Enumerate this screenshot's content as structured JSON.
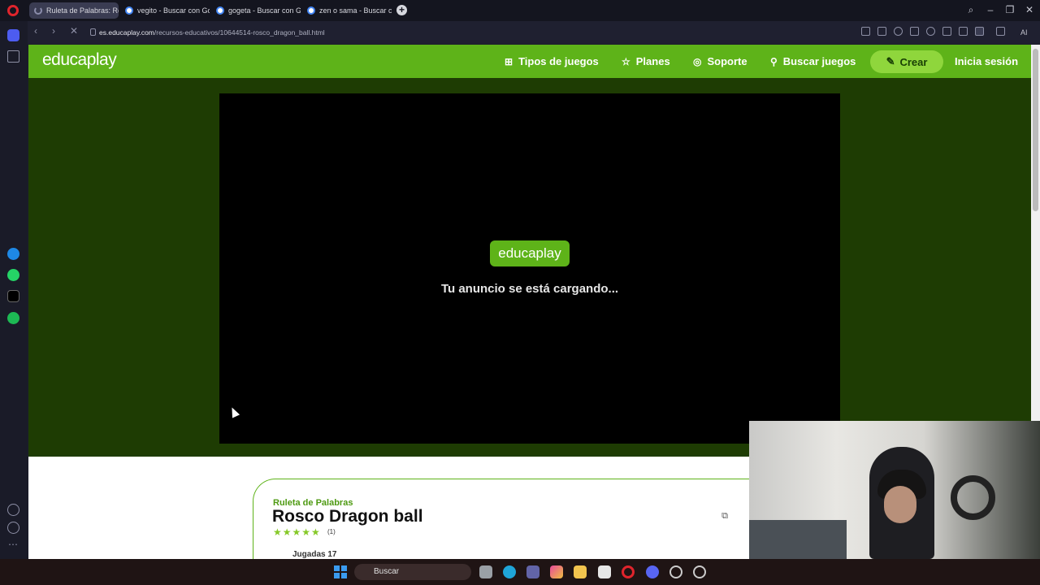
{
  "browser": {
    "tabs": [
      {
        "title": "Ruleta de Palabras: Rosco",
        "active": true
      },
      {
        "title": "vegito - Buscar con Google",
        "active": false
      },
      {
        "title": "gogeta - Buscar con Google",
        "active": false
      },
      {
        "title": "zen o sama - Buscar con Google",
        "active": false
      }
    ],
    "new_tab": "+",
    "url_domain": "es.educaplay.com",
    "url_path": "/recursos-educativos/10644514-rosco_dragon_ball.html",
    "ai_label": "AI"
  },
  "site": {
    "logo": "educaplay",
    "nav": {
      "tipos": "Tipos de juegos",
      "planes": "Planes",
      "soporte": "Soporte",
      "buscar": "Buscar juegos",
      "crear": "Crear",
      "login": "Inicia sesión"
    },
    "ad": {
      "logo": "educaplay",
      "message": "Tu anuncio se está cargando..."
    },
    "card": {
      "type": "Ruleta de Palabras",
      "title": "Rosco Dragon ball",
      "stars": "★★★★★",
      "rating_count": "(1)",
      "plays": "Jugadas 17"
    }
  },
  "taskbar": {
    "search_placeholder": "Buscar"
  },
  "colors": {
    "brand_green": "#5eb319",
    "dark_green_bg": "#1e3c03",
    "crear_bg": "#8fd63c"
  }
}
